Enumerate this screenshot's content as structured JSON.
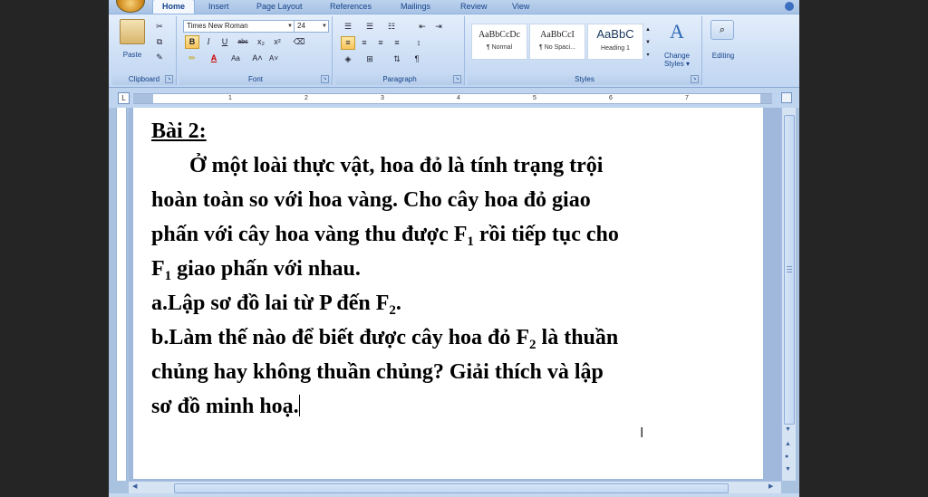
{
  "tabs": [
    "Home",
    "Insert",
    "Page Layout",
    "References",
    "Mailings",
    "Review",
    "View"
  ],
  "active_tab": "Home",
  "ribbon": {
    "clipboard": {
      "label": "Clipboard",
      "paste": "Paste"
    },
    "font": {
      "label": "Font",
      "family": "Times New Roman",
      "size": "24"
    },
    "paragraph": {
      "label": "Paragraph"
    },
    "styles": {
      "label": "Styles",
      "items": [
        {
          "preview": "AaBbCcDc",
          "name": "¶ Normal"
        },
        {
          "preview": "AaBbCcI",
          "name": "¶ No Spaci..."
        },
        {
          "preview": "AaBbC",
          "name": "Heading 1"
        }
      ],
      "change": "Change Styles",
      "change_arrow": "▾"
    },
    "editing": {
      "label": "Editing"
    }
  },
  "ruler": {
    "numbers": [
      "1",
      "2",
      "3",
      "4",
      "5",
      "6",
      "7"
    ]
  },
  "document": {
    "title": "Bài 2:",
    "l1": "Ở một loài thực vật, hoa đỏ là tính trạng trội",
    "l2": "hoàn toàn so với hoa vàng. Cho cây hoa đỏ giao",
    "l3a": "phấn với cây hoa vàng thu được F",
    "l3sub": "1",
    "l3b": " rồi tiếp tục cho",
    "l4a": "F",
    "l4sub": "1",
    "l4b": " giao phấn với nhau.",
    "l5a": "a.Lập sơ đồ lai từ P đến F",
    "l5sub": "2",
    "l5b": ".",
    "l6a": "b.Làm thế nào để biết được cây hoa đỏ F",
    "l6sub": "2",
    "l6b": " là thuần",
    "l7": "chủng hay không thuần chủng? Giải thích và lập",
    "l8": "sơ đồ minh hoạ."
  }
}
